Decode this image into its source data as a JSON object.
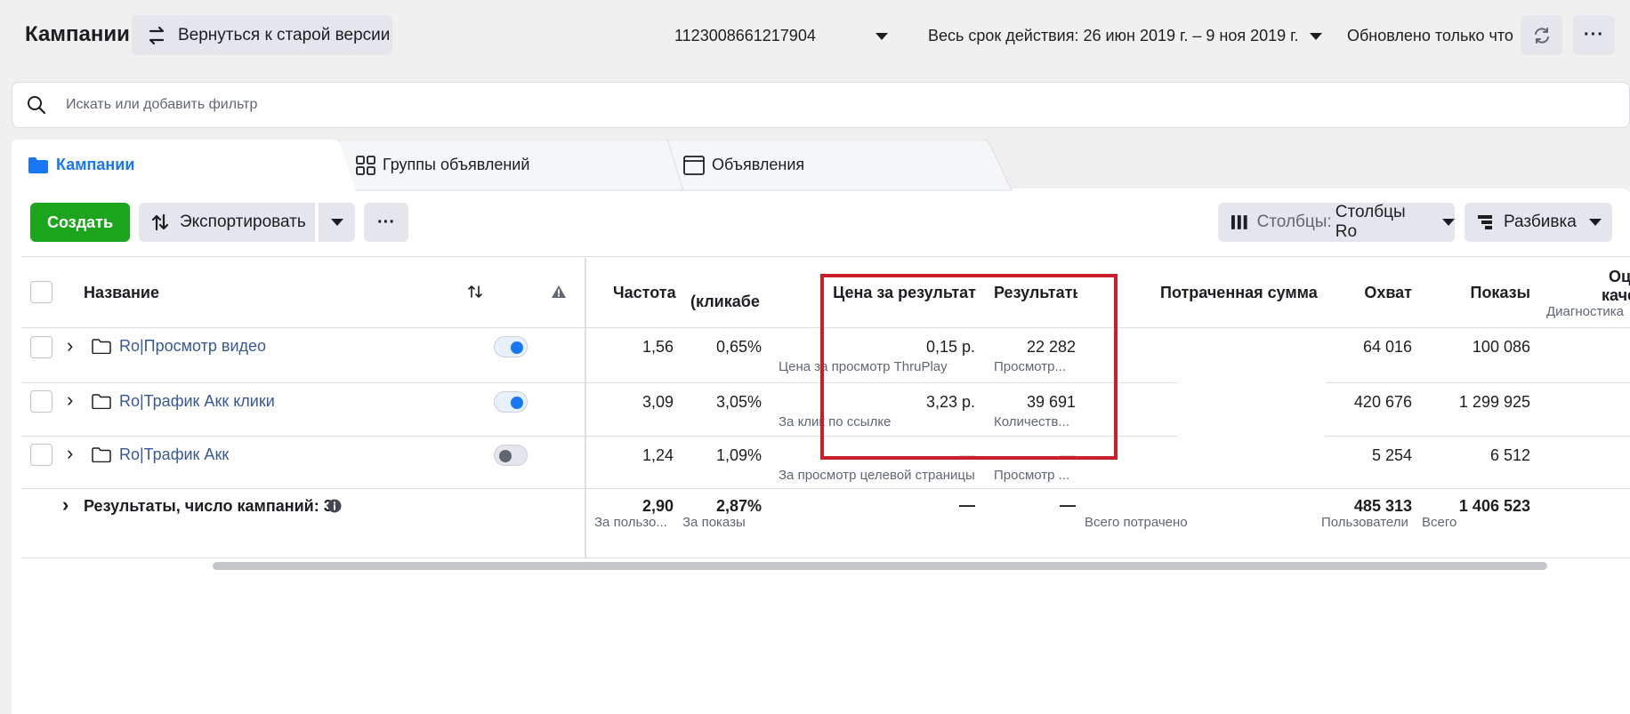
{
  "header": {
    "title": "Кампании",
    "old_version_label": "Вернуться к старой версии",
    "account_id": "1123008661217904",
    "date_range": "Весь срок действия: 26 июн 2019 г. – 9 ноя 2019 г.",
    "updated": "Обновлено только что"
  },
  "search": {
    "placeholder": "Искать или добавить фильтр"
  },
  "tabs": [
    {
      "label": "Кампании",
      "active": true
    },
    {
      "label": "Группы объявлений",
      "active": false
    },
    {
      "label": "Объявления",
      "active": false
    }
  ],
  "toolbar": {
    "create_label": "Создать",
    "export_label": "Экспортировать",
    "columns_prefix": "Столбцы:",
    "columns_value": "Столбцы Ro",
    "breakdown_label": "Разбивка"
  },
  "table": {
    "headers": {
      "name": "Название",
      "frequency": "Частота",
      "ctr": "(кликабе",
      "cost_per_result": "Цена за результат",
      "results": "Результать",
      "spent": "Потраченная сумма",
      "reach": "Охват",
      "impressions": "Показы",
      "quality": "Оц",
      "quality2": "каче",
      "diagnostics": "Диагностика"
    },
    "rows": [
      {
        "name": "Ro|Просмотр видео",
        "toggle_on": true,
        "frequency": "1,56",
        "ctr": "0,65%",
        "cost": "0,15 р.",
        "cost_sub": "Цена за просмотр ThruPlay",
        "results": "22 282",
        "results_sub": "Просмотр...",
        "reach": "64 016",
        "impressions": "100 086"
      },
      {
        "name": "Ro|Трафик Акк клики",
        "toggle_on": true,
        "frequency": "3,09",
        "ctr": "3,05%",
        "cost": "3,23 р.",
        "cost_sub": "За клик по ссылке",
        "results": "39 691",
        "results_sub": "Количеств...",
        "reach": "420 676",
        "impressions": "1 299 925"
      },
      {
        "name": "Ro|Трафик Акк",
        "toggle_on": false,
        "frequency": "1,24",
        "ctr": "1,09%",
        "cost": "—",
        "cost_sub": "За просмотр целевой страницы",
        "results": "—",
        "results_sub": "Просмотр ...",
        "reach": "5 254",
        "impressions": "6 512"
      }
    ],
    "summary": {
      "label": "Результаты, число кампаний: 3",
      "frequency": "2,90",
      "frequency_sub": "За пользо...",
      "ctr": "2,87%",
      "ctr_sub": "За показы",
      "cost": "—",
      "results": "—",
      "spent_sub": "Всего потрачено",
      "reach": "485 313",
      "reach_sub": "Пользователи",
      "impressions": "1 406 523",
      "impressions_sub": "Всего"
    }
  },
  "colors": {
    "accent": "#1877f2",
    "create": "#1ea51e",
    "highlight": "#c8202b",
    "link": "#385898"
  },
  "icons": [
    "refresh-icon",
    "more-icon",
    "search-icon",
    "folder-icon",
    "grid-icon",
    "ad-icon",
    "export-icon",
    "columns-icon",
    "breakdown-icon",
    "sort-icon",
    "warning-icon",
    "info-icon"
  ]
}
